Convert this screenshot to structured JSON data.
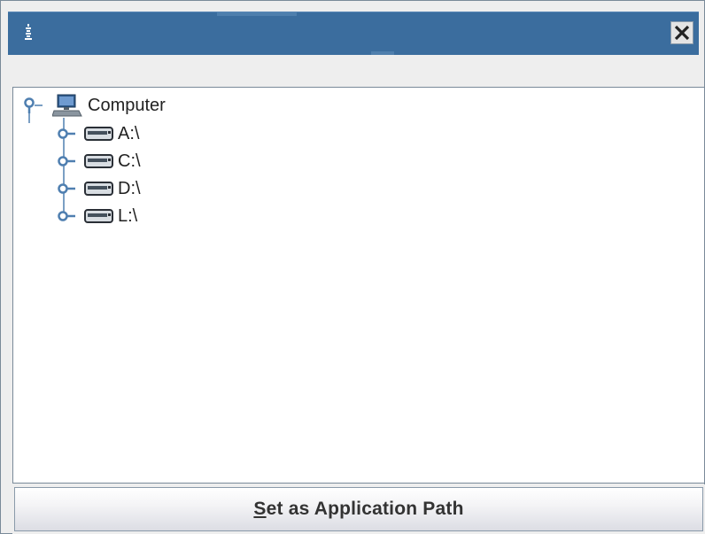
{
  "window": {
    "title": "",
    "close_glyph": "✕"
  },
  "tree": {
    "root": {
      "label": "Computer",
      "icon": "computer-icon",
      "expanded": true
    },
    "children": [
      {
        "label": "A:\\",
        "icon": "drive-icon"
      },
      {
        "label": "C:\\",
        "icon": "drive-icon"
      },
      {
        "label": "D:\\",
        "icon": "drive-icon"
      },
      {
        "label": "L:\\",
        "icon": "drive-icon"
      }
    ]
  },
  "actions": {
    "set_path_mnemonic": "S",
    "set_path_rest": "et as Application Path"
  },
  "colors": {
    "titlebar": "#3b6d9e",
    "tree_lines": "#4f7fb0"
  }
}
